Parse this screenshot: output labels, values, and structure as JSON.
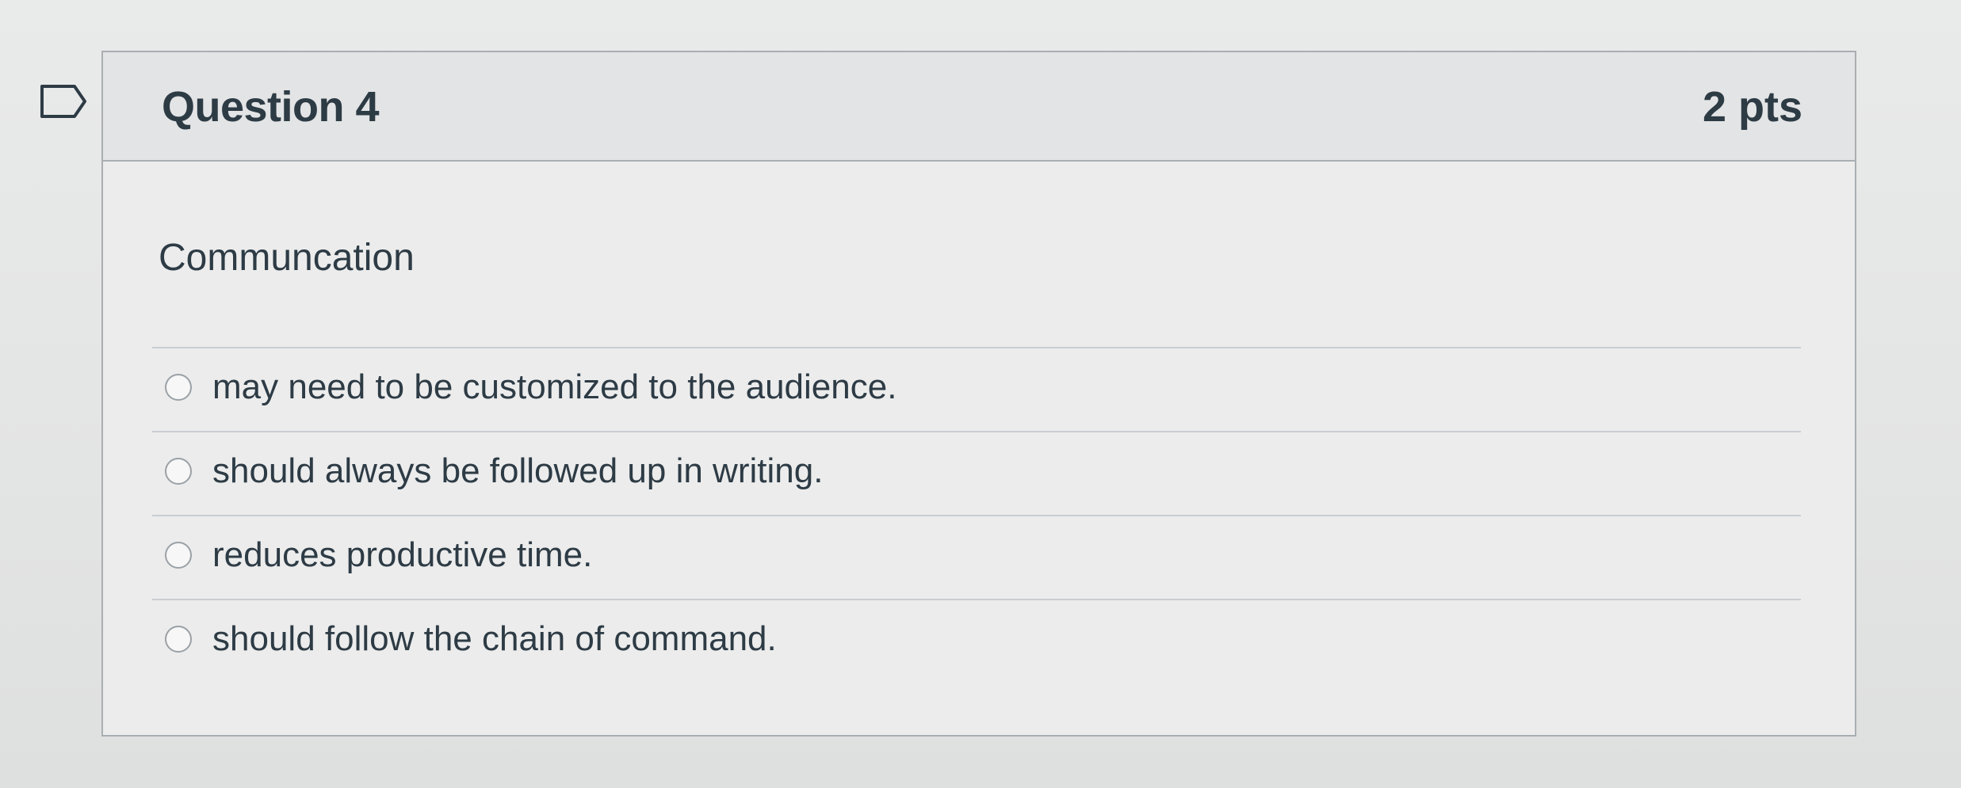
{
  "question": {
    "title": "Question 4",
    "points": "2 pts",
    "flag_icon": "flag-outline-icon",
    "prompt": "Communcation"
  },
  "answers": [
    {
      "label": "may need to be customized to the audience.",
      "selected": false
    },
    {
      "label": "should always be followed up in writing.",
      "selected": false
    },
    {
      "label": "reduces productive time.",
      "selected": false
    },
    {
      "label": "should follow the chain of command.",
      "selected": false
    }
  ],
  "colors": {
    "text": "#2d3b45",
    "border": "#a9aeb2",
    "header_bg": "#e3e4e5"
  }
}
